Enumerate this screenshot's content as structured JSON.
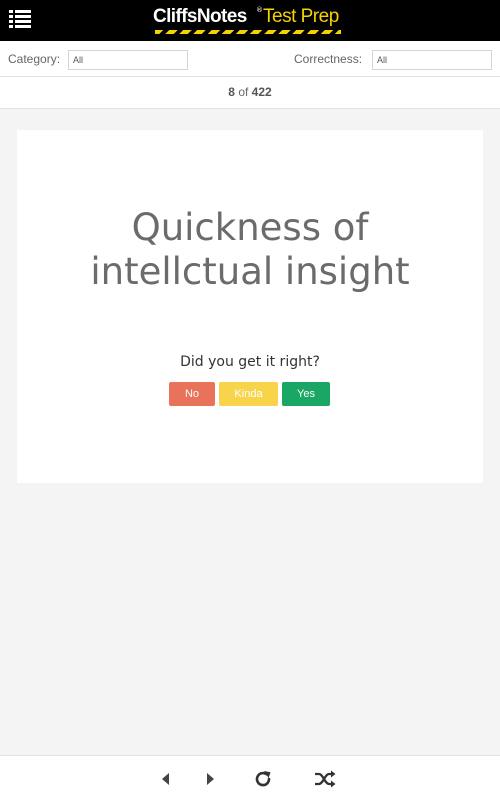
{
  "header": {
    "logo_brand": "CliffsNotes",
    "logo_registered": "®",
    "logo_product": "Test Prep",
    "menu_icon": "hamburger-menu-icon",
    "brand_color": "#f5d300"
  },
  "filters": {
    "category_label": "Category:",
    "category_value": "All",
    "correctness_label": "Correctness:",
    "correctness_value": "All"
  },
  "counter": {
    "current": "8",
    "of_label": "of",
    "total": "422"
  },
  "card": {
    "term": "Quickness of intellctual insight",
    "question": "Did you get it right?",
    "buttons": {
      "no": "No",
      "kinda": "Kinda",
      "yes": "Yes"
    },
    "colors": {
      "no": "#e8735a",
      "kinda": "#f7d44a",
      "yes": "#1aa665"
    }
  },
  "bottom_nav": {
    "icons": [
      "previous-icon",
      "next-icon",
      "refresh-icon",
      "shuffle-icon"
    ]
  }
}
